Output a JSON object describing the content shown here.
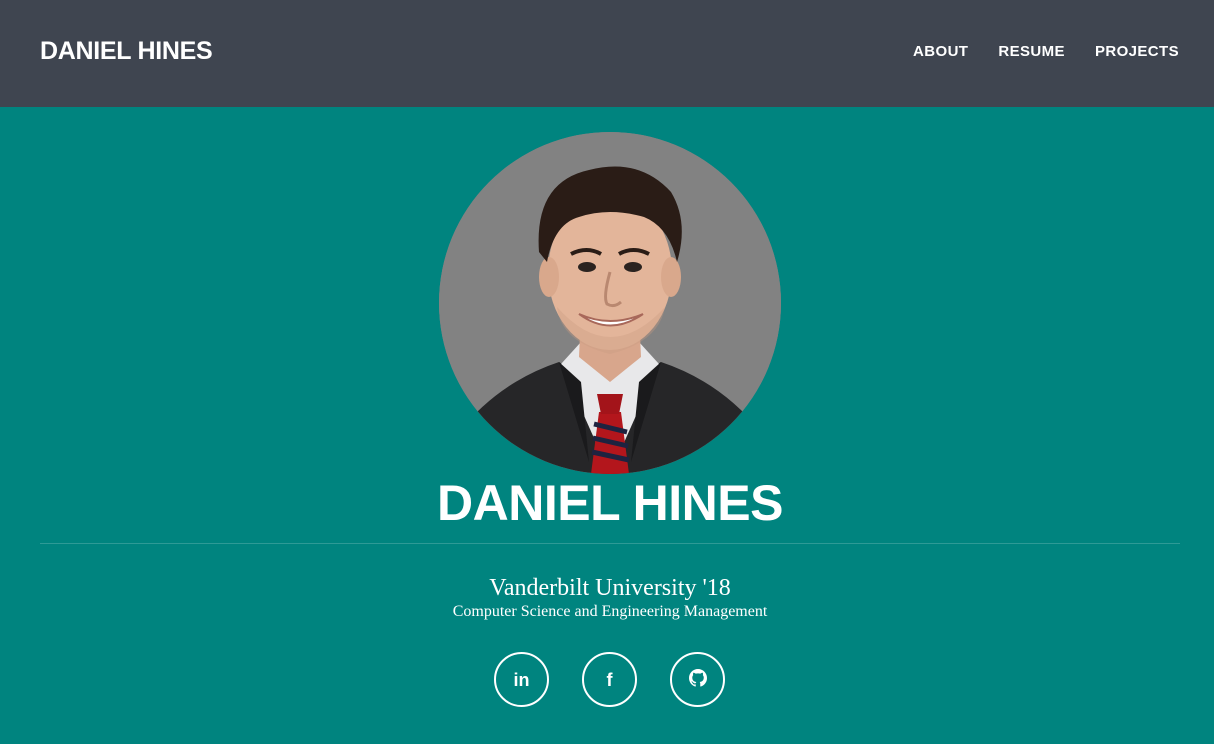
{
  "navbar": {
    "brand": "DANIEL HINES",
    "links": [
      "ABOUT",
      "RESUME",
      "PROJECTS"
    ]
  },
  "hero": {
    "name": "DANIEL HINES",
    "school": "Vanderbilt University '18",
    "major": "Computer Science and Engineering Management"
  },
  "social": [
    {
      "icon": "linkedin-icon",
      "glyph": "in"
    },
    {
      "icon": "facebook-icon",
      "glyph": "f"
    },
    {
      "icon": "github-icon",
      "glyph": ""
    }
  ],
  "colors": {
    "navbar_bg": "#3f4550",
    "page_bg": "#00847f",
    "text": "#ffffff"
  }
}
